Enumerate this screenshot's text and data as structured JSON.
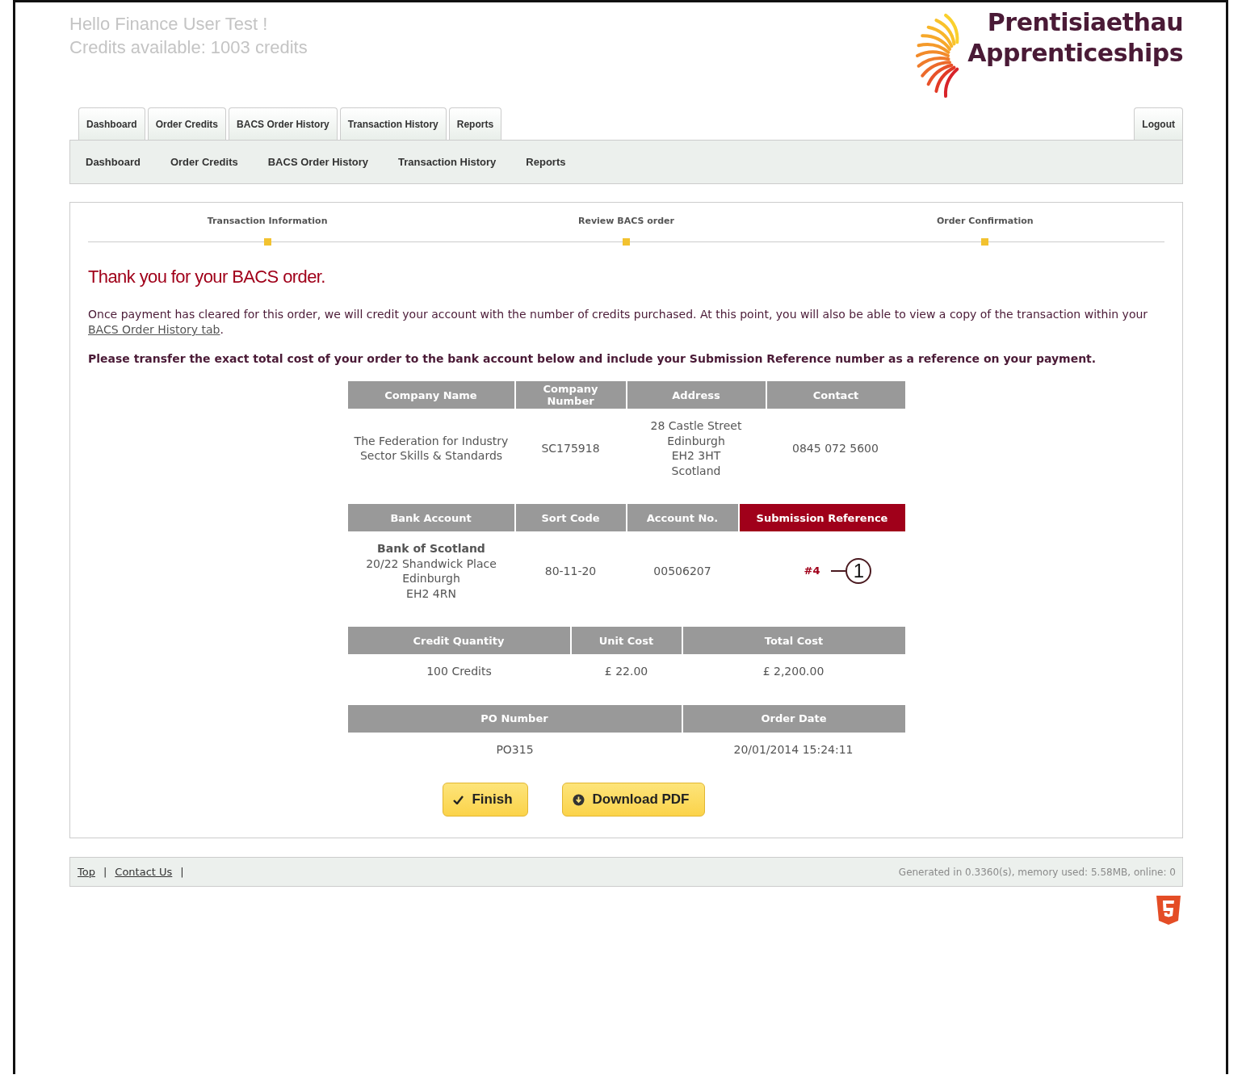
{
  "header": {
    "greeting": "Hello Finance User Test !",
    "credits": "Credits available: 1003 credits",
    "logo": {
      "line_1": "Prentisiaethau",
      "line_2": "Apprenticeships"
    }
  },
  "tabs": [
    {
      "label": "Dashboard"
    },
    {
      "label": "Order Credits"
    },
    {
      "label": "BACS Order History"
    },
    {
      "label": "Transaction History"
    },
    {
      "label": "Reports"
    }
  ],
  "logout": "Logout",
  "subnav": [
    "Dashboard",
    "Order Credits",
    "BACS Order History",
    "Transaction History",
    "Reports"
  ],
  "steps": [
    "Transaction Information",
    "Review BACS order",
    "Order Confirmation"
  ],
  "heading": "Thank you for your BACS order.",
  "intro": {
    "text": "Once payment has cleared for this order, we will credit your account with the number of credits purchased. At this point, you will also be able to view a copy of the transaction within your",
    "link": "BACS Order History tab",
    "end": "."
  },
  "instruction": "Please transfer the exact total cost of your order to the bank account below and include your Submission Reference number as a reference on your payment.",
  "tables": [
    {
      "columns": [
        {
          "label": "Company Name",
          "highlighted": false
        },
        {
          "label": "Company Number",
          "highlighted": false
        },
        {
          "label": "Address",
          "highlighted": false
        },
        {
          "label": "Contact",
          "highlighted": false
        }
      ],
      "row": [
        [
          "The Federation for Industry Sector Skills & Standards"
        ],
        [
          "SC175918"
        ],
        [
          "28 Castle Street",
          "Edinburgh",
          "EH2 3HT",
          "Scotland"
        ],
        [
          "0845 072 5600"
        ]
      ]
    },
    {
      "columns": [
        {
          "label": "Bank Account",
          "highlighted": false
        },
        {
          "label": "Sort Code",
          "highlighted": false
        },
        {
          "label": "Account No.",
          "highlighted": false
        },
        {
          "label": "Submission Reference",
          "highlighted": true
        }
      ],
      "row": [
        [
          "**Bank of Scotland**",
          "20/22 Shandwick Place",
          "Edinburgh",
          "EH2 4RN"
        ],
        [
          "80-11-20"
        ],
        [
          "00506207"
        ],
        [
          "#4"
        ]
      ],
      "callout": "1"
    },
    {
      "columns": [
        {
          "label": "Credit Quantity",
          "highlighted": false
        },
        {
          "label": "Unit Cost",
          "highlighted": false
        },
        {
          "label": "Total Cost",
          "highlighted": false
        }
      ],
      "row": [
        [
          "100 Credits"
        ],
        [
          "£ 22.00"
        ],
        [
          "£ 2,200.00"
        ]
      ]
    },
    {
      "columns": [
        {
          "label": "PO Number",
          "highlighted": false
        },
        {
          "label": "Order Date",
          "highlighted": false
        }
      ],
      "row": [
        [
          "PO315"
        ],
        [
          "20/01/2014 15:24:11"
        ]
      ]
    }
  ],
  "buttons": [
    {
      "kind": "check",
      "label": "Finish"
    },
    {
      "kind": "download",
      "label": "Download PDF"
    }
  ],
  "footer": {
    "items": [
      {
        "kind": "link",
        "text": "Top"
      },
      {
        "kind": "sep",
        "text": "|"
      },
      {
        "kind": "link",
        "text": "Contact Us"
      },
      {
        "kind": "sep",
        "text": "|"
      }
    ],
    "stats": "Generated in 0.3360(s), memory used: 5.58MB, online: 0"
  }
}
